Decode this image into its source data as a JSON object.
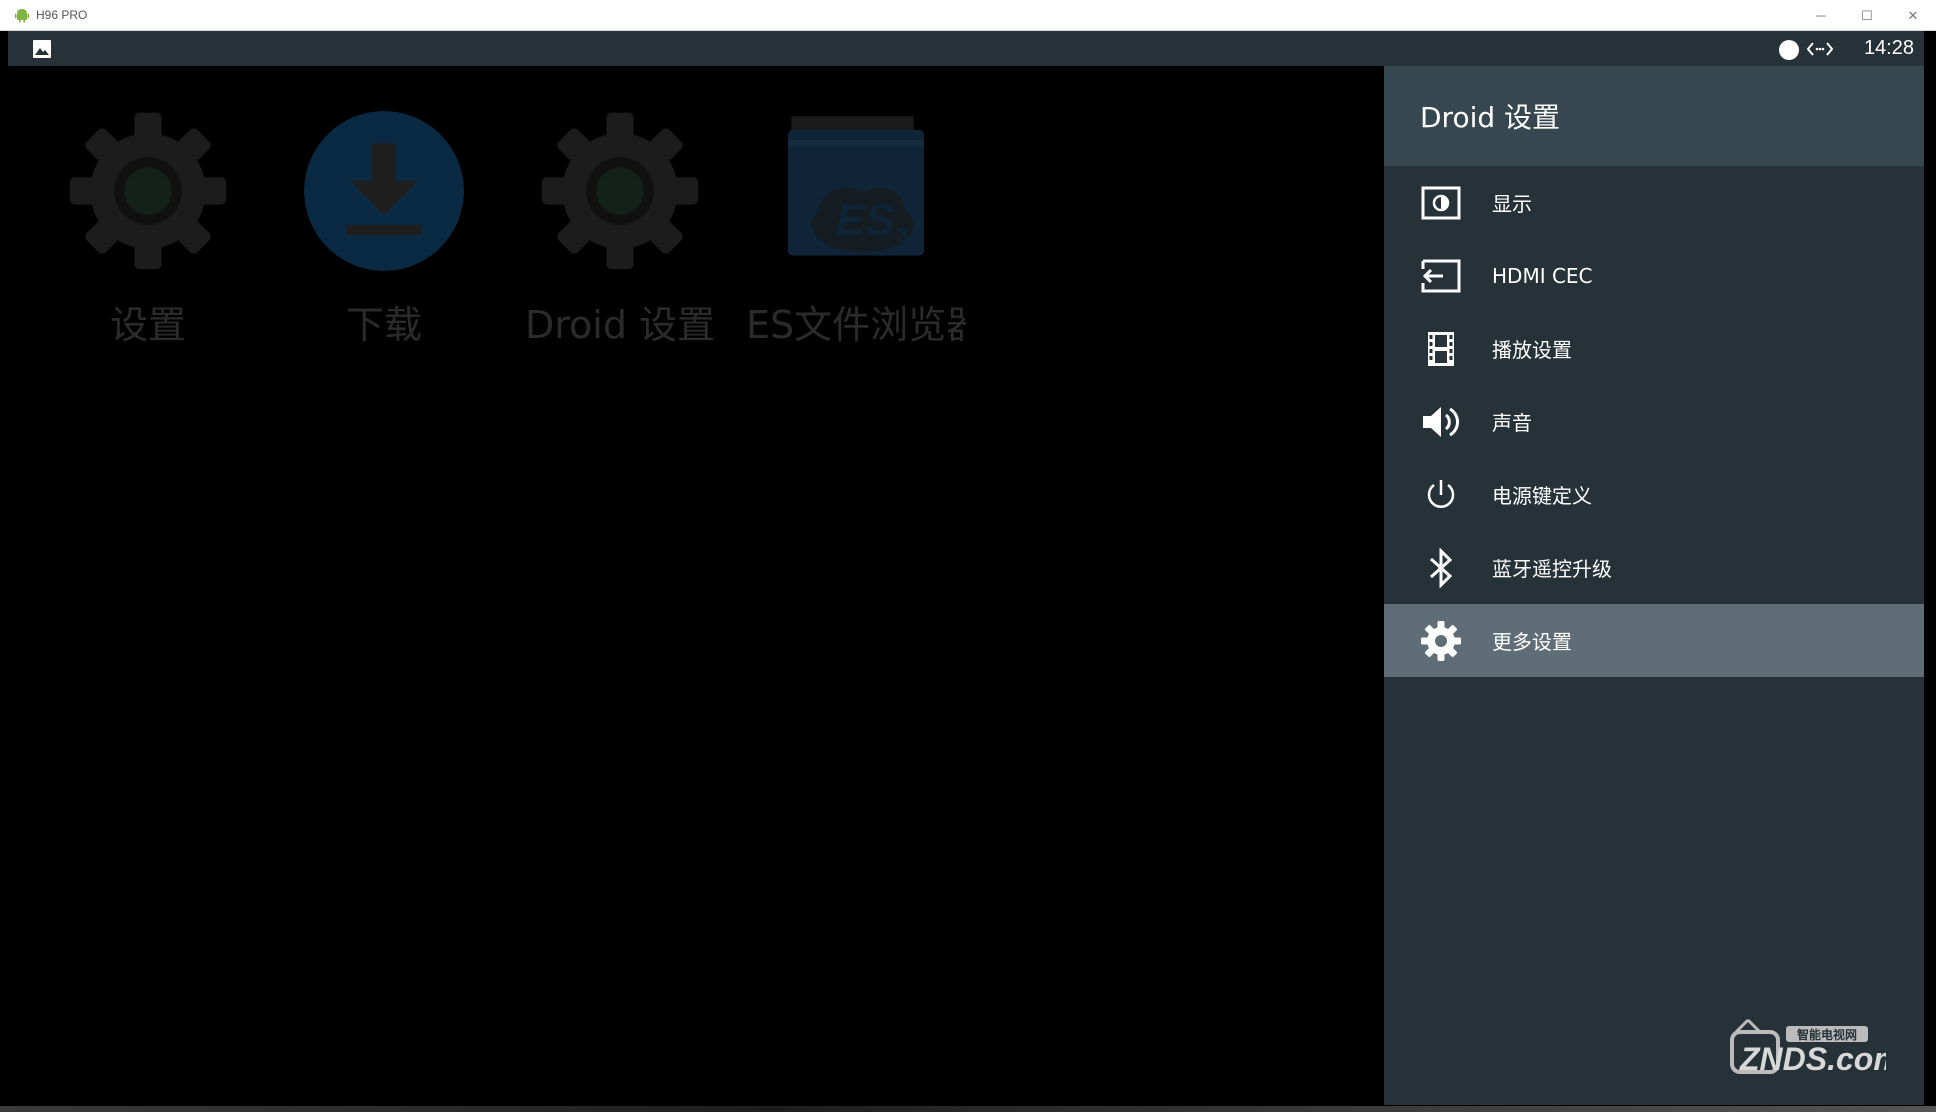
{
  "window": {
    "title": "H96 PRO",
    "controls": {
      "minimize": "─",
      "maximize": "☐",
      "close": "✕"
    }
  },
  "statusbar": {
    "time": "14:28",
    "icons": [
      "image-icon",
      "record-dot-icon",
      "network-arrows-icon"
    ]
  },
  "launcher": {
    "apps": [
      {
        "label": "设置",
        "icon": "gear-icon"
      },
      {
        "label": "下载",
        "icon": "download-icon"
      },
      {
        "label": "Droid 设置",
        "icon": "gear-icon"
      },
      {
        "label": "ES文件浏览器",
        "icon": "es-file-explorer-icon"
      }
    ]
  },
  "drawer": {
    "title": "Droid 设置",
    "items": [
      {
        "label": "显示",
        "icon": "display-icon"
      },
      {
        "label": "HDMI CEC",
        "icon": "hdmi-input-icon"
      },
      {
        "label": "播放设置",
        "icon": "film-icon"
      },
      {
        "label": "声音",
        "icon": "speaker-icon"
      },
      {
        "label": "电源键定义",
        "icon": "power-icon"
      },
      {
        "label": "蓝牙遥控升级",
        "icon": "bluetooth-icon"
      },
      {
        "label": "更多设置",
        "icon": "gear-icon",
        "selected": true
      }
    ]
  },
  "colors": {
    "statusbar": "#263238",
    "drawer": "#263238",
    "drawer_header": "#37474f",
    "selected_item": "#5f6e76",
    "download_blue": "#0a2a44"
  },
  "watermark": {
    "brand": "ZNDS.com",
    "tagline": "智能电视网"
  }
}
